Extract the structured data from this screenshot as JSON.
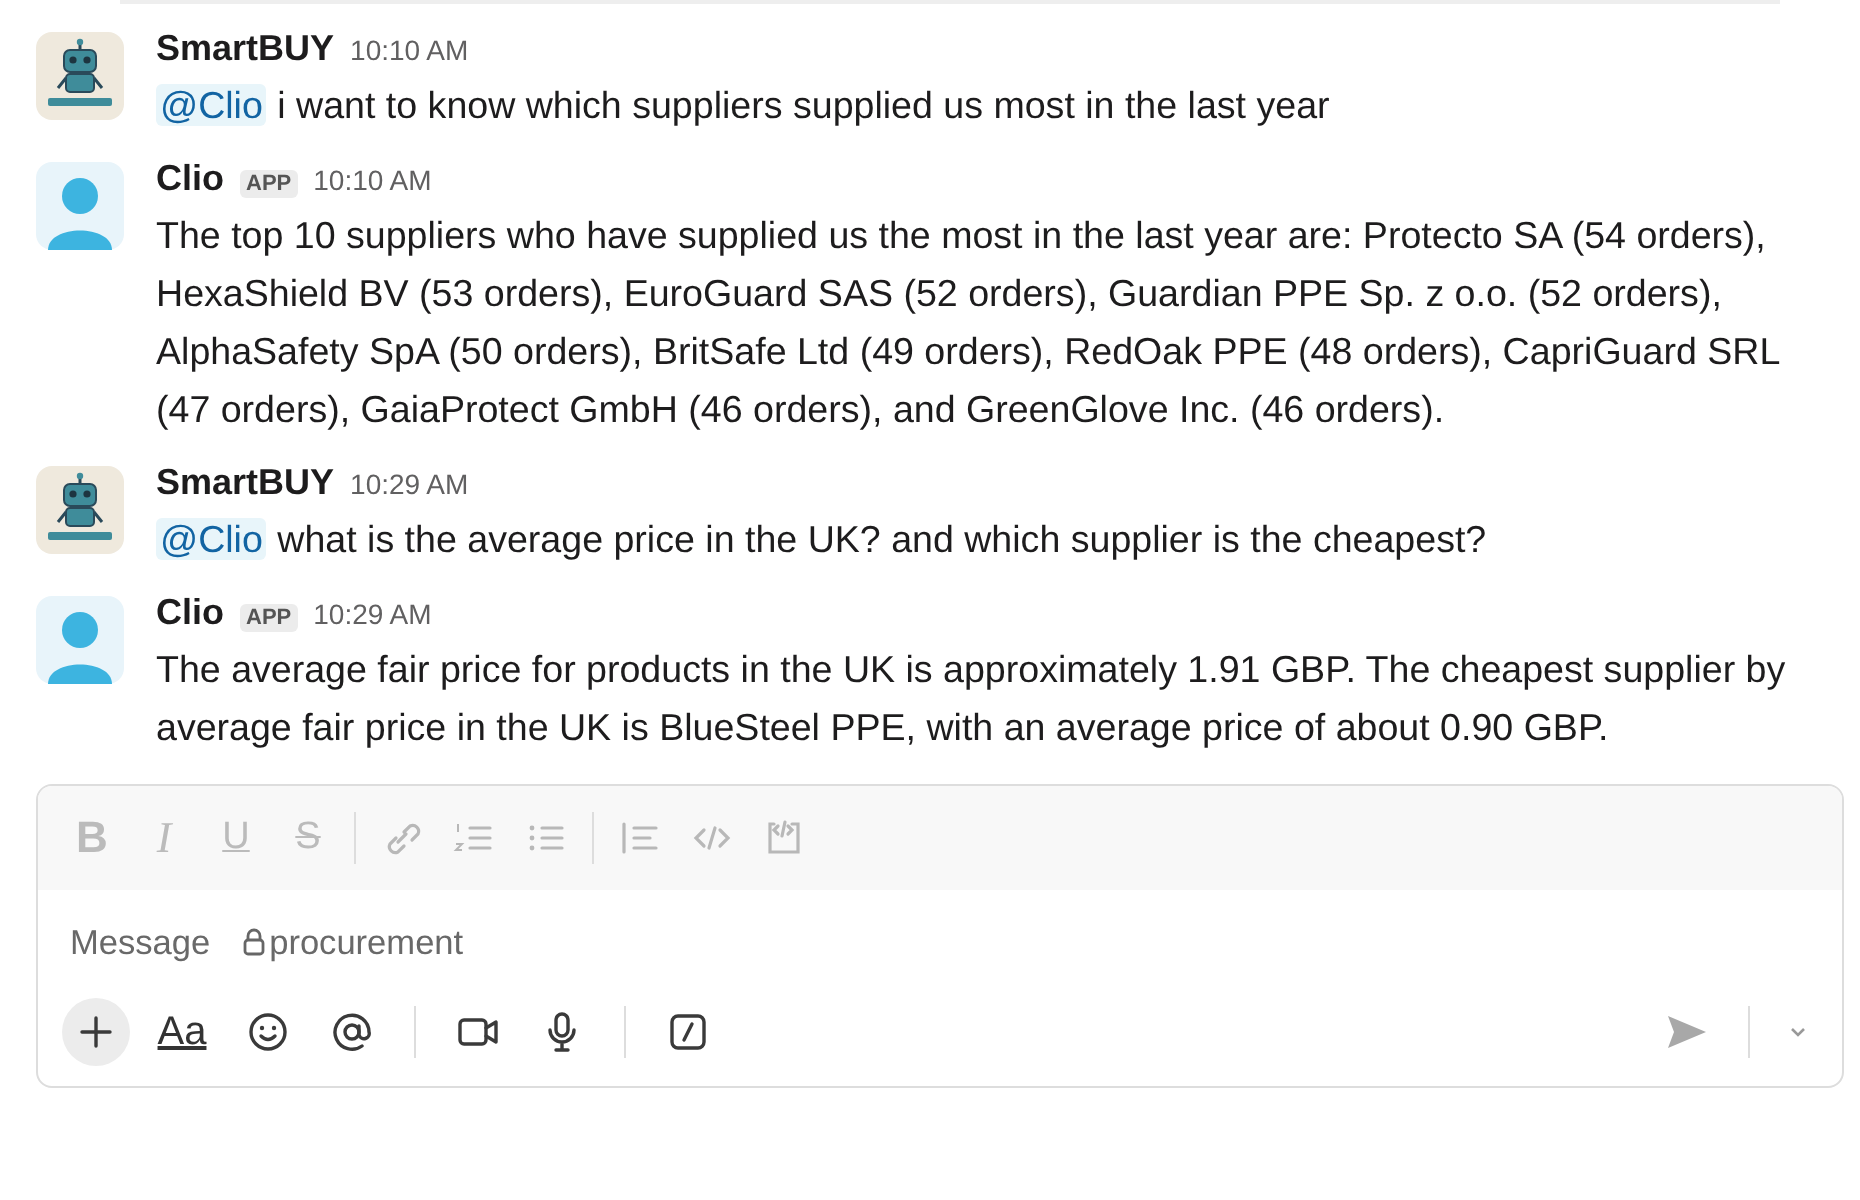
{
  "messages": [
    {
      "kind": "user",
      "author": "SmartBUY",
      "time": "10:10 AM",
      "mention": "@Clio",
      "text": "i want to know which suppliers supplied us most in the last year"
    },
    {
      "kind": "bot",
      "author": "Clio",
      "badge": "APP",
      "time": "10:10 AM",
      "text": "The top 10 suppliers who have supplied us the most in the last year are: Protecto SA (54 orders), HexaShield BV (53 orders), EuroGuard SAS (52 orders), Guardian PPE Sp. z o.o. (52 orders), AlphaSafety SpA (50 orders), BritSafe Ltd (49 orders), RedOak PPE (48 orders), CapriGuard SRL (47 orders), GaiaProtect GmbH (46 orders), and GreenGlove Inc. (46 orders)."
    },
    {
      "kind": "user",
      "author": "SmartBUY",
      "time": "10:29 AM",
      "mention": "@Clio",
      "text": "what is the average price in the UK? and which supplier is the cheapest?"
    },
    {
      "kind": "bot",
      "author": "Clio",
      "badge": "APP",
      "time": "10:29 AM",
      "text": "The average fair price for products in the UK is approximately 1.91 GBP. The cheapest supplier by average fair price in the UK is BlueSteel PPE, with an average price of about 0.90 GBP."
    }
  ],
  "composer": {
    "format_toolbar": [
      {
        "kind": "bold",
        "label": "B"
      },
      {
        "kind": "italic",
        "label": "I"
      },
      {
        "kind": "underline",
        "label": "U"
      },
      {
        "kind": "strike",
        "label": "S"
      },
      {
        "kind": "divider"
      },
      {
        "kind": "link"
      },
      {
        "kind": "ordered-list"
      },
      {
        "kind": "bullet-list"
      },
      {
        "kind": "divider"
      },
      {
        "kind": "quote"
      },
      {
        "kind": "code"
      },
      {
        "kind": "code-block"
      }
    ],
    "placeholder": "Message",
    "channel": "procurement",
    "actions": [
      {
        "kind": "plus"
      },
      {
        "kind": "text",
        "label": "Aa"
      },
      {
        "kind": "emoji"
      },
      {
        "kind": "mention"
      },
      {
        "kind": "divider"
      },
      {
        "kind": "video"
      },
      {
        "kind": "mic"
      },
      {
        "kind": "divider"
      },
      {
        "kind": "shortcut"
      }
    ]
  }
}
